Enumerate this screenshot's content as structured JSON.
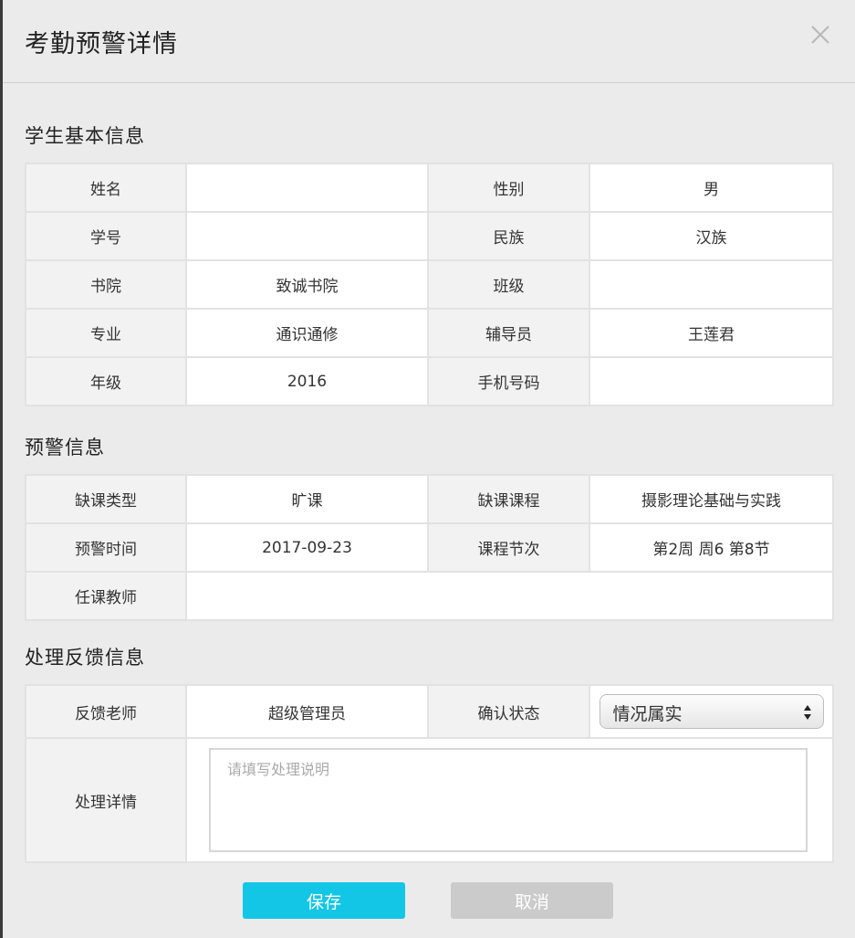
{
  "modal": {
    "title": "考勤预警详情"
  },
  "student": {
    "section_title": "学生基本信息",
    "rows": [
      [
        "姓名",
        "",
        "性别",
        "男"
      ],
      [
        "学号",
        "",
        "民族",
        "汉族"
      ],
      [
        "书院",
        "致诚书院",
        "班级",
        ""
      ],
      [
        "专业",
        "通识通修",
        "辅导员",
        "王莲君"
      ],
      [
        "年级",
        "2016",
        "手机号码",
        ""
      ]
    ]
  },
  "warning": {
    "section_title": "预警信息",
    "rows": [
      [
        "缺课类型",
        "旷课",
        "缺课课程",
        "摄影理论基础与实践"
      ],
      [
        "预警时间",
        "2017-09-23",
        "课程节次",
        "第2周 周6 第8节"
      ]
    ],
    "teacher_label": "任课教师",
    "teacher_value": ""
  },
  "feedback": {
    "section_title": "处理反馈信息",
    "teacher_label": "反馈老师",
    "teacher_value": "超级管理员",
    "status_label": "确认状态",
    "status_value": "情况属实",
    "detail_label": "处理详情",
    "detail_placeholder": "请填写处理说明"
  },
  "buttons": {
    "save": "保存",
    "cancel": "取消"
  }
}
